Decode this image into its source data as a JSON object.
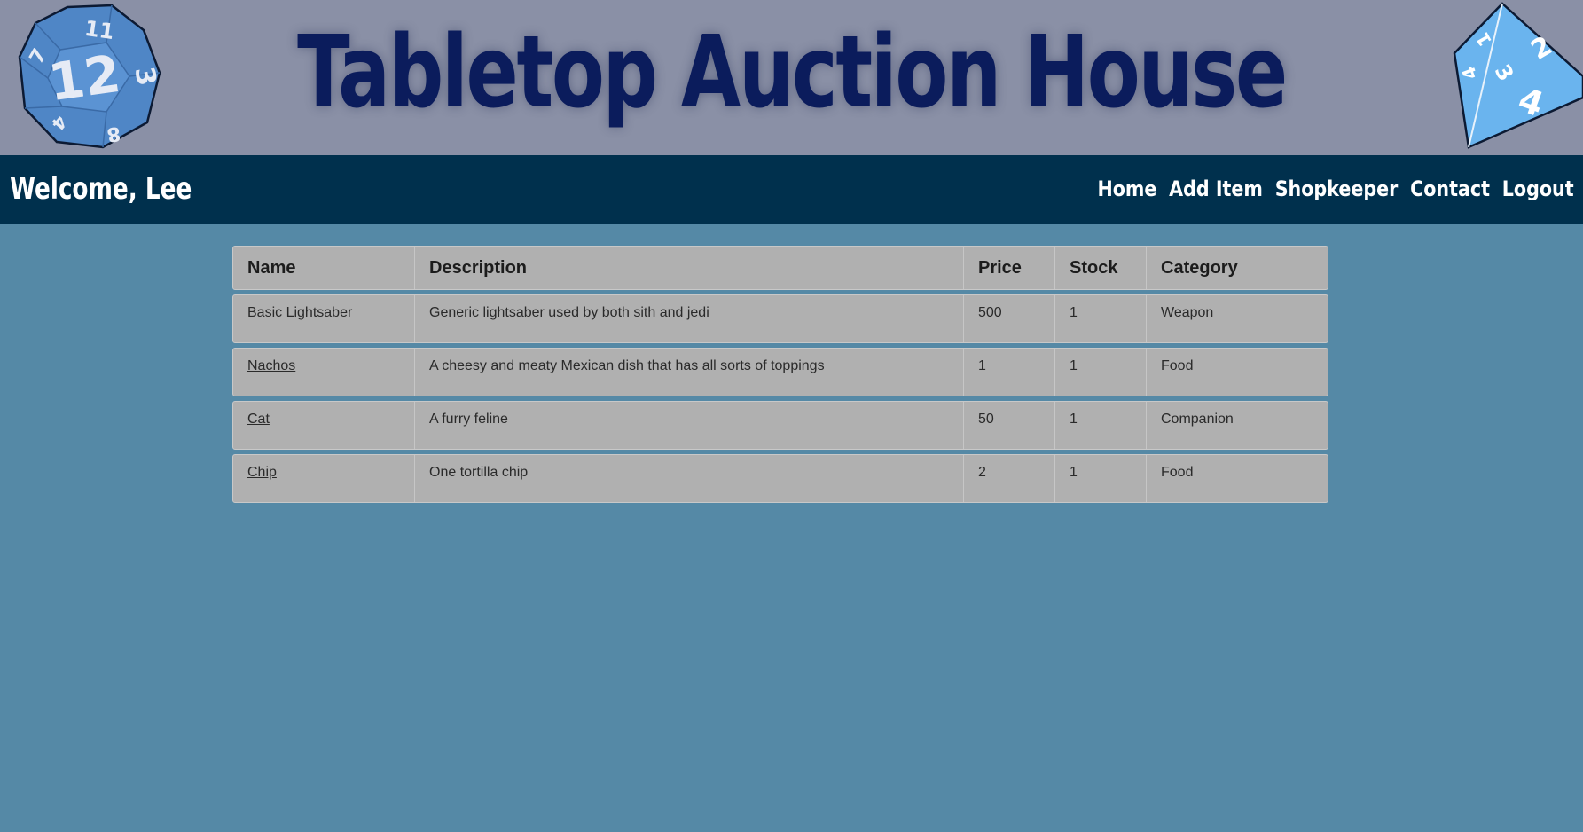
{
  "banner": {
    "title": "Tabletop Auction House",
    "left_die_icon": "d12-die-icon",
    "right_die_icon": "d4-die-icon"
  },
  "navbar": {
    "welcome": "Welcome, Lee",
    "links": [
      "Home",
      "Add Item",
      "Shopkeeper",
      "Contact",
      "Logout"
    ]
  },
  "table": {
    "headers": [
      "Name",
      "Description",
      "Price",
      "Stock",
      "Category"
    ],
    "rows": [
      {
        "name": "Basic Lightsaber",
        "description": "Generic lightsaber used by both sith and jedi",
        "price": "500",
        "stock": "1",
        "category": "Weapon"
      },
      {
        "name": "Nachos",
        "description": "A cheesy and meaty Mexican dish that has all sorts of toppings",
        "price": "1",
        "stock": "1",
        "category": "Food"
      },
      {
        "name": "Cat",
        "description": "A furry feline",
        "price": "50",
        "stock": "1",
        "category": "Companion"
      },
      {
        "name": "Chip",
        "description": "One tortilla chip",
        "price": "2",
        "stock": "1",
        "category": "Food"
      }
    ]
  },
  "colors": {
    "banner_bg": "#8a90a6",
    "title": "#0b1c5c",
    "navbar_bg": "#00304d",
    "page_bg": "#5589a6",
    "table_row_bg": "#b0b0b0"
  }
}
